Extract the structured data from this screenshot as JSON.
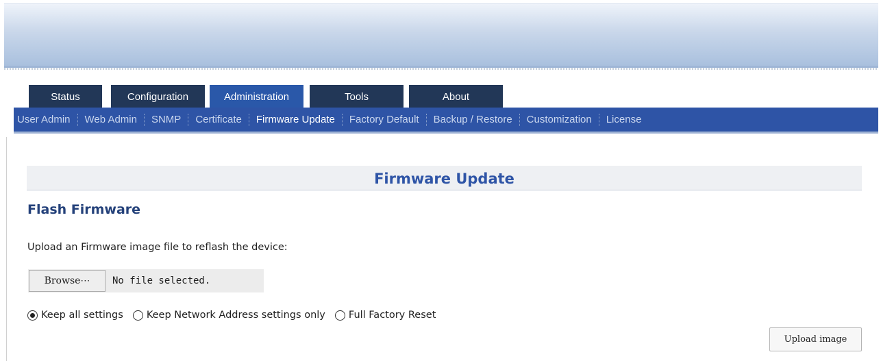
{
  "tabs": [
    {
      "label": "Status",
      "active": false
    },
    {
      "label": "Configuration",
      "active": false
    },
    {
      "label": "Administration",
      "active": true
    },
    {
      "label": "Tools",
      "active": false
    },
    {
      "label": "About",
      "active": false
    }
  ],
  "subnav": [
    {
      "label": "User Admin",
      "active": false
    },
    {
      "label": "Web Admin",
      "active": false
    },
    {
      "label": "SNMP",
      "active": false
    },
    {
      "label": "Certificate",
      "active": false
    },
    {
      "label": "Firmware Update",
      "active": true
    },
    {
      "label": "Factory Default",
      "active": false
    },
    {
      "label": "Backup / Restore",
      "active": false
    },
    {
      "label": "Customization",
      "active": false
    },
    {
      "label": "License",
      "active": false
    }
  ],
  "page": {
    "section_title": "Firmware Update",
    "subheading": "Flash Firmware",
    "instruction": "Upload an Firmware image file to reflash the device:"
  },
  "file_input": {
    "browse_label": "Browse⋯",
    "status": "No file selected."
  },
  "options": [
    {
      "label": "Keep all settings",
      "checked": true
    },
    {
      "label": "Keep Network Address settings only",
      "checked": false
    },
    {
      "label": "Full Factory Reset",
      "checked": false
    }
  ],
  "upload_button": "Upload image",
  "colors": {
    "tab_bg": "#223757",
    "tab_active_bg": "#2a58a9",
    "subnav_bg": "#2e54a6",
    "heading": "#2e54a6"
  }
}
